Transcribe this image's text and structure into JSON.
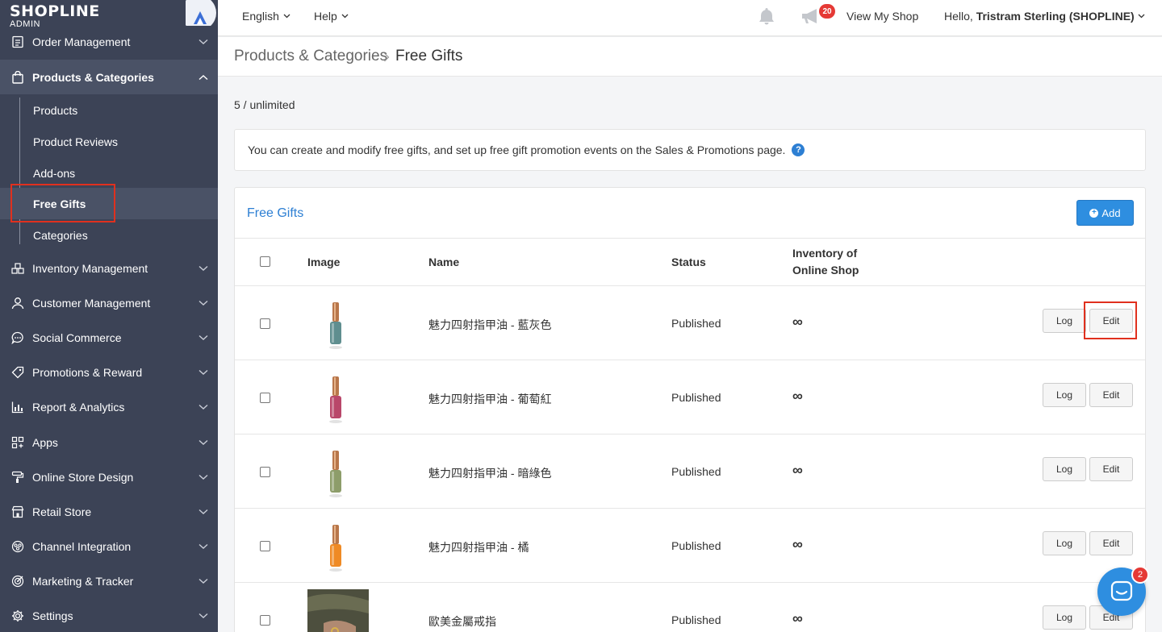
{
  "logo": {
    "brand": "SHOPLINE",
    "sub": "ADMIN"
  },
  "sidebar": {
    "items": [
      {
        "label": "Order Management",
        "icon": "clipboard-icon"
      },
      {
        "label": "Products & Categories",
        "icon": "bag-icon"
      },
      {
        "label": "Inventory Management",
        "icon": "boxes-icon"
      },
      {
        "label": "Customer Management",
        "icon": "user-icon"
      },
      {
        "label": "Social Commerce",
        "icon": "chat-bubble-icon"
      },
      {
        "label": "Promotions & Reward",
        "icon": "tag-icon"
      },
      {
        "label": "Report & Analytics",
        "icon": "bar-chart-icon"
      },
      {
        "label": "Apps",
        "icon": "apps-grid-icon"
      },
      {
        "label": "Online Store Design",
        "icon": "paint-roller-icon"
      },
      {
        "label": "Retail Store",
        "icon": "store-icon"
      },
      {
        "label": "Channel Integration",
        "icon": "integration-icon"
      },
      {
        "label": "Marketing & Tracker",
        "icon": "target-icon"
      },
      {
        "label": "Settings",
        "icon": "gear-icon"
      }
    ],
    "subitems": [
      "Products",
      "Product Reviews",
      "Add-ons",
      "Free Gifts",
      "Categories"
    ]
  },
  "topbar": {
    "language": "English",
    "help": "Help",
    "notifications_count": "20",
    "view_shop": "View My Shop",
    "greeting": "Hello, ",
    "user": "Tristram Sterling (SHOPLINE)"
  },
  "breadcrumb": {
    "parent": "Products & Categories",
    "current": "Free Gifts"
  },
  "count_text": "5 / unlimited",
  "info_text": "You can create and modify free gifts, and set up free gift promotion events on the Sales & Promotions page.",
  "panel": {
    "title": "Free Gifts",
    "add_label": "Add",
    "headers": {
      "image": "Image",
      "name": "Name",
      "status": "Status",
      "inventory_line1": "Inventory of",
      "inventory_line2": "Online Shop"
    }
  },
  "rows": [
    {
      "name": "魅力四射指甲油 - 藍灰色",
      "status": "Published",
      "inventory": "∞",
      "color": "#5f8e8f"
    },
    {
      "name": "魅力四射指甲油 - 葡萄紅",
      "status": "Published",
      "inventory": "∞",
      "color": "#b9476a"
    },
    {
      "name": "魅力四射指甲油 - 暗綠色",
      "status": "Published",
      "inventory": "∞",
      "color": "#8d9d6a"
    },
    {
      "name": "魅力四射指甲油 - 橘",
      "status": "Published",
      "inventory": "∞",
      "color": "#ef8a25"
    },
    {
      "name": "歐美金屬戒指",
      "status": "Published",
      "inventory": "∞",
      "color": "#5a5a48"
    }
  ],
  "row_buttons": {
    "log": "Log",
    "edit": "Edit"
  },
  "chat_badge": "2",
  "colors": {
    "sidebar": "#3c4356",
    "accent": "#2e8ee0",
    "highlight": "#e0301e"
  }
}
